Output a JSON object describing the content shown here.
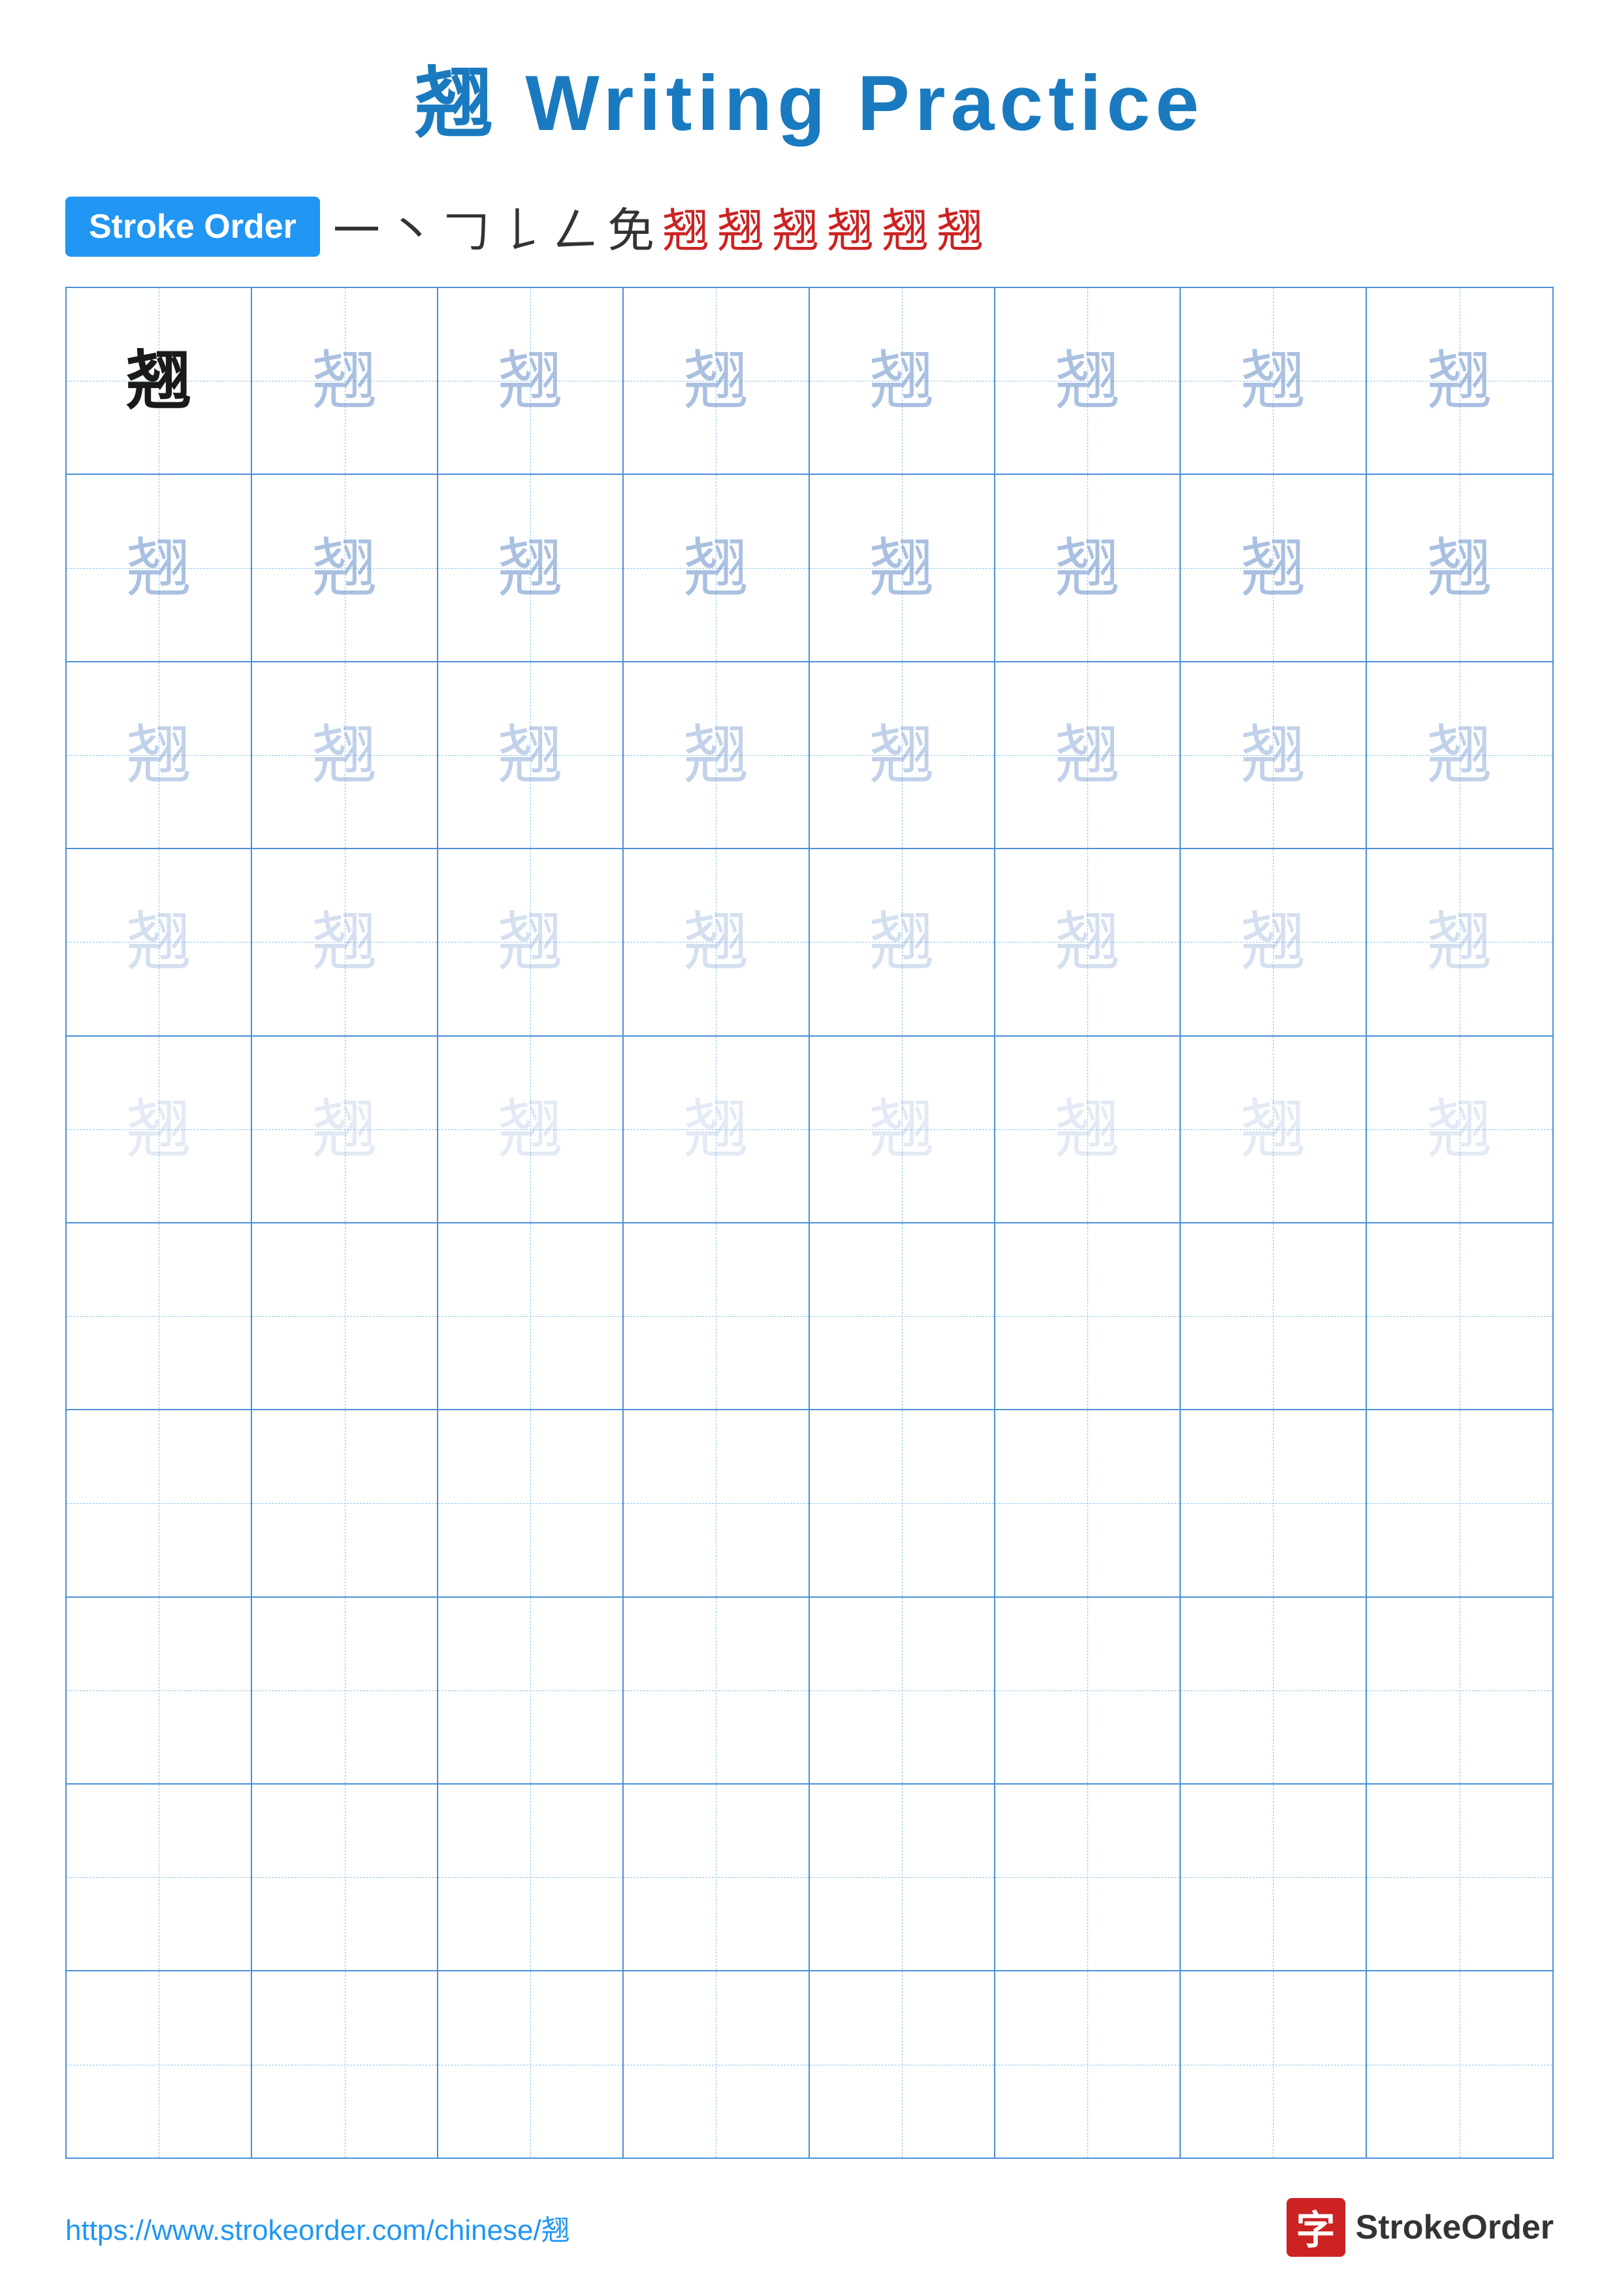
{
  "title": {
    "char": "翘",
    "label": "Writing Practice",
    "full": "翘 Writing Practice"
  },
  "stroke_order": {
    "badge_label": "Stroke Order",
    "strokes": [
      "一",
      "丶",
      "𠃌",
      "𠄌",
      "𠃋",
      "免",
      "翘",
      "翘",
      "翘",
      "翘",
      "翘",
      "翘"
    ]
  },
  "grid": {
    "rows": 10,
    "cols": 8,
    "char": "翘",
    "practice_rows": [
      [
        {
          "char": "翘",
          "style": "dark"
        },
        {
          "char": "翘",
          "style": "light1"
        },
        {
          "char": "翘",
          "style": "light1"
        },
        {
          "char": "翘",
          "style": "light1"
        },
        {
          "char": "翘",
          "style": "light1"
        },
        {
          "char": "翘",
          "style": "light1"
        },
        {
          "char": "翘",
          "style": "light1"
        },
        {
          "char": "翘",
          "style": "light1"
        }
      ],
      [
        {
          "char": "翘",
          "style": "light1"
        },
        {
          "char": "翘",
          "style": "light1"
        },
        {
          "char": "翘",
          "style": "light1"
        },
        {
          "char": "翘",
          "style": "light1"
        },
        {
          "char": "翘",
          "style": "light1"
        },
        {
          "char": "翘",
          "style": "light1"
        },
        {
          "char": "翘",
          "style": "light1"
        },
        {
          "char": "翘",
          "style": "light1"
        }
      ],
      [
        {
          "char": "翘",
          "style": "light2"
        },
        {
          "char": "翘",
          "style": "light2"
        },
        {
          "char": "翘",
          "style": "light2"
        },
        {
          "char": "翘",
          "style": "light2"
        },
        {
          "char": "翘",
          "style": "light2"
        },
        {
          "char": "翘",
          "style": "light2"
        },
        {
          "char": "翘",
          "style": "light2"
        },
        {
          "char": "翘",
          "style": "light2"
        }
      ],
      [
        {
          "char": "翘",
          "style": "light3"
        },
        {
          "char": "翘",
          "style": "light3"
        },
        {
          "char": "翘",
          "style": "light3"
        },
        {
          "char": "翘",
          "style": "light3"
        },
        {
          "char": "翘",
          "style": "light3"
        },
        {
          "char": "翘",
          "style": "light3"
        },
        {
          "char": "翘",
          "style": "light3"
        },
        {
          "char": "翘",
          "style": "light3"
        }
      ],
      [
        {
          "char": "翘",
          "style": "light4"
        },
        {
          "char": "翘",
          "style": "light4"
        },
        {
          "char": "翘",
          "style": "light4"
        },
        {
          "char": "翘",
          "style": "light4"
        },
        {
          "char": "翘",
          "style": "light4"
        },
        {
          "char": "翘",
          "style": "light4"
        },
        {
          "char": "翘",
          "style": "light4"
        },
        {
          "char": "翘",
          "style": "light4"
        }
      ],
      [
        {
          "char": "",
          "style": "empty"
        },
        {
          "char": "",
          "style": "empty"
        },
        {
          "char": "",
          "style": "empty"
        },
        {
          "char": "",
          "style": "empty"
        },
        {
          "char": "",
          "style": "empty"
        },
        {
          "char": "",
          "style": "empty"
        },
        {
          "char": "",
          "style": "empty"
        },
        {
          "char": "",
          "style": "empty"
        }
      ],
      [
        {
          "char": "",
          "style": "empty"
        },
        {
          "char": "",
          "style": "empty"
        },
        {
          "char": "",
          "style": "empty"
        },
        {
          "char": "",
          "style": "empty"
        },
        {
          "char": "",
          "style": "empty"
        },
        {
          "char": "",
          "style": "empty"
        },
        {
          "char": "",
          "style": "empty"
        },
        {
          "char": "",
          "style": "empty"
        }
      ],
      [
        {
          "char": "",
          "style": "empty"
        },
        {
          "char": "",
          "style": "empty"
        },
        {
          "char": "",
          "style": "empty"
        },
        {
          "char": "",
          "style": "empty"
        },
        {
          "char": "",
          "style": "empty"
        },
        {
          "char": "",
          "style": "empty"
        },
        {
          "char": "",
          "style": "empty"
        },
        {
          "char": "",
          "style": "empty"
        }
      ],
      [
        {
          "char": "",
          "style": "empty"
        },
        {
          "char": "",
          "style": "empty"
        },
        {
          "char": "",
          "style": "empty"
        },
        {
          "char": "",
          "style": "empty"
        },
        {
          "char": "",
          "style": "empty"
        },
        {
          "char": "",
          "style": "empty"
        },
        {
          "char": "",
          "style": "empty"
        },
        {
          "char": "",
          "style": "empty"
        }
      ],
      [
        {
          "char": "",
          "style": "empty"
        },
        {
          "char": "",
          "style": "empty"
        },
        {
          "char": "",
          "style": "empty"
        },
        {
          "char": "",
          "style": "empty"
        },
        {
          "char": "",
          "style": "empty"
        },
        {
          "char": "",
          "style": "empty"
        },
        {
          "char": "",
          "style": "empty"
        },
        {
          "char": "",
          "style": "empty"
        }
      ]
    ]
  },
  "footer": {
    "url": "https://www.strokeorder.com/chinese/翘",
    "brand_name": "StrokeOrder",
    "brand_char": "字"
  }
}
